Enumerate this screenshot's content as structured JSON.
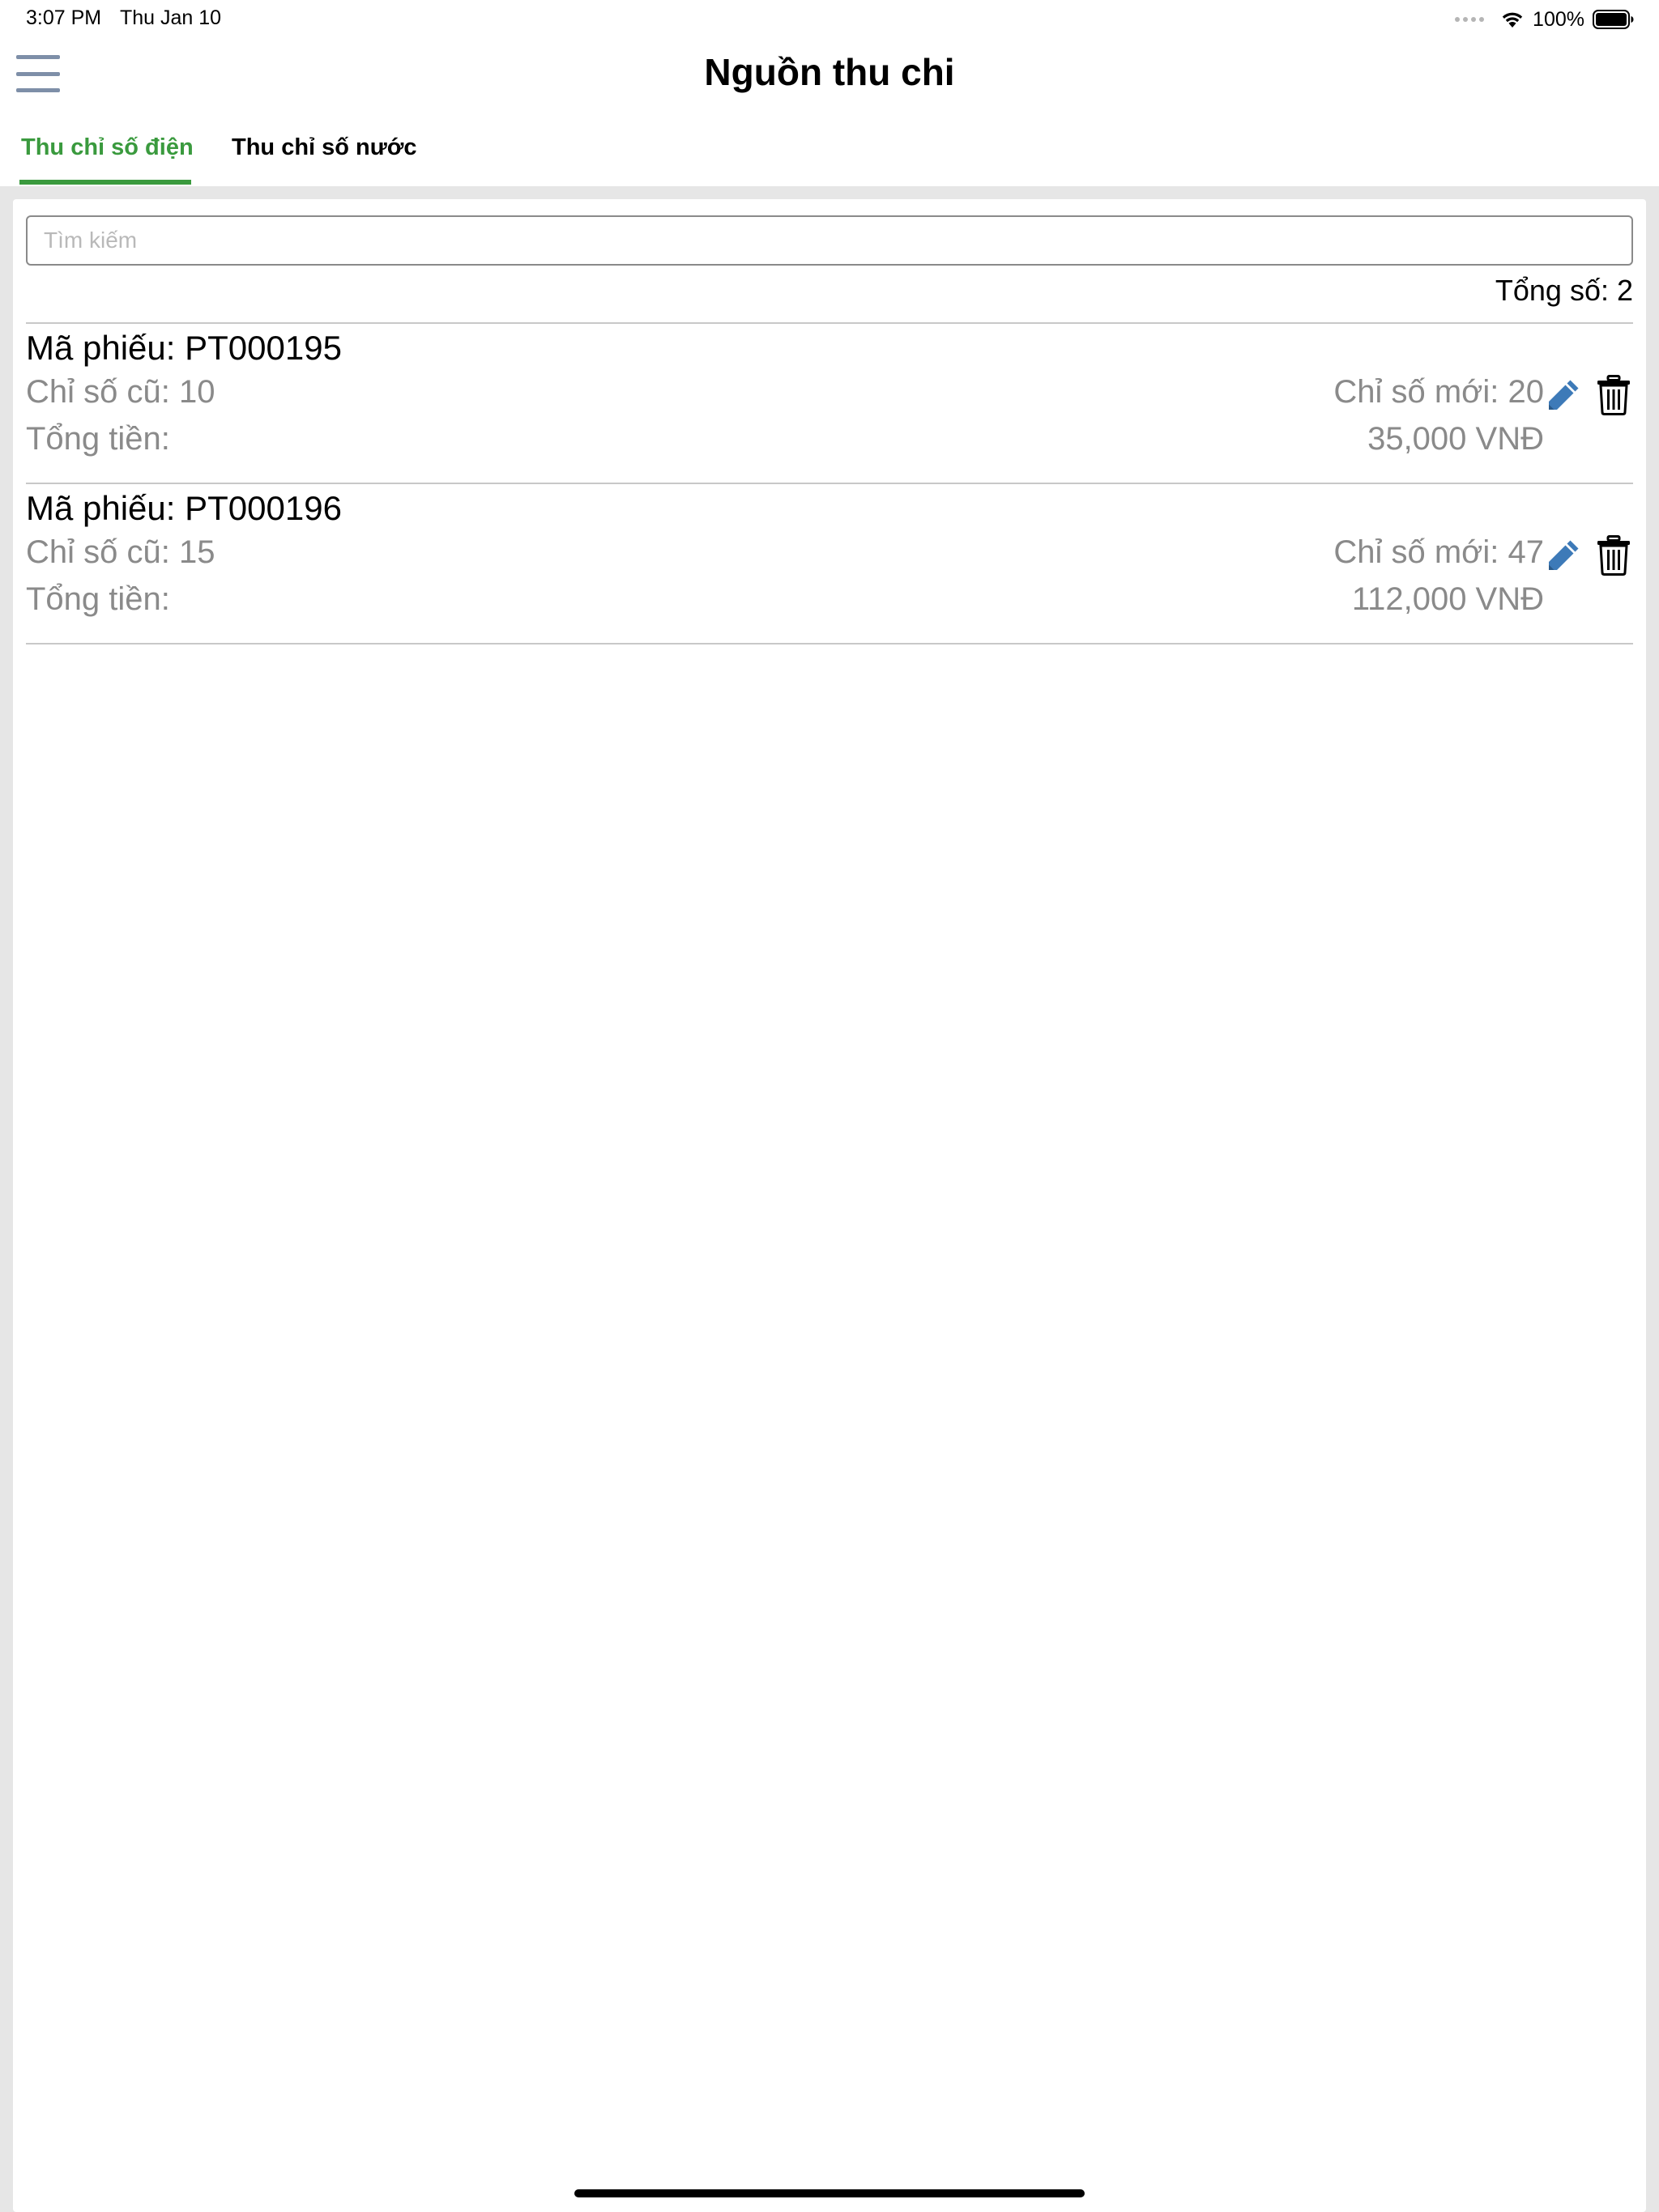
{
  "status_bar": {
    "time": "3:07 PM",
    "date": "Thu Jan 10",
    "battery_percent": "100%",
    "icons": [
      "signal-dots-icon",
      "wifi-icon",
      "battery-icon"
    ]
  },
  "header": {
    "title": "Nguồn thu chi",
    "menu_icon": "hamburger-menu-icon"
  },
  "tabs": [
    {
      "label": "Thu chỉ số điện",
      "active": true
    },
    {
      "label": "Thu chỉ số nước",
      "active": false
    }
  ],
  "search": {
    "placeholder": "Tìm kiếm",
    "value": ""
  },
  "summary": {
    "total_label": "Tổng số: 2"
  },
  "receipts": [
    {
      "code": "Mã phiếu: PT000195",
      "old_reading": "Chỉ số cũ: 10",
      "new_reading": "Chỉ số mới: 20",
      "total_label": "Tổng tiền:",
      "amount": "35,000 VNĐ"
    },
    {
      "code": "Mã phiếu: PT000196",
      "old_reading": "Chỉ số cũ: 15",
      "new_reading": "Chỉ số mới: 47",
      "total_label": "Tổng tiền:",
      "amount": "112,000 VNĐ"
    }
  ],
  "colors": {
    "accent_green": "#3a9a3e",
    "edit_blue": "#3d7ab8",
    "muted_text": "#8a8a8a",
    "menu_icon": "#7e8fa8"
  }
}
